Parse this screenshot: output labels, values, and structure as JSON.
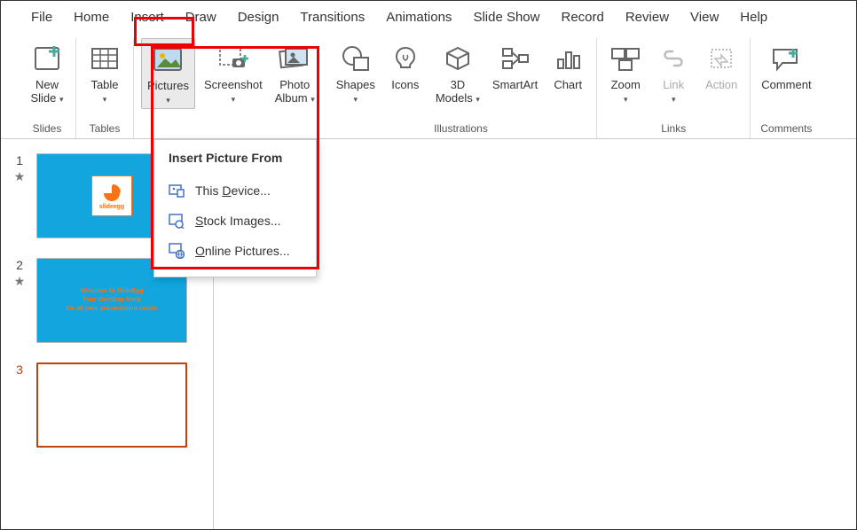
{
  "tabs": {
    "file": "File",
    "home": "Home",
    "insert": "Insert",
    "draw": "Draw",
    "design": "Design",
    "transitions": "Transitions",
    "animations": "Animations",
    "slide_show": "Slide Show",
    "record": "Record",
    "review": "Review",
    "view": "View",
    "help": "Help"
  },
  "ribbon": {
    "new_slide": "New\nSlide",
    "table": "Table",
    "pictures": "Pictures",
    "screenshot": "Screenshot",
    "photo_album": "Photo\nAlbum",
    "shapes": "Shapes",
    "icons": "Icons",
    "models3d": "3D\nModels",
    "smartart": "SmartArt",
    "chart": "Chart",
    "zoom": "Zoom",
    "link": "Link",
    "action": "Action",
    "comment": "Comment",
    "groups": {
      "slides": "Slides",
      "tables": "Tables",
      "illustrations": "Illustrations",
      "links": "Links",
      "comments": "Comments"
    }
  },
  "dropdown": {
    "header": "Insert Picture From",
    "this_device_pre": "This ",
    "this_device_u": "D",
    "this_device_post": "evice...",
    "stock_pre": "",
    "stock_u": "S",
    "stock_post": "tock Images...",
    "online_pre": "",
    "online_u": "O",
    "online_post": "nline Pictures..."
  },
  "slides": {
    "s1": {
      "num": "1",
      "logo": "slideegg"
    },
    "s2": {
      "num": "2",
      "line1": "Welcome to SlideEgg",
      "line2": "Your OneStop Shop",
      "line3": "for all your presentation needs"
    },
    "s3": {
      "num": "3"
    }
  }
}
